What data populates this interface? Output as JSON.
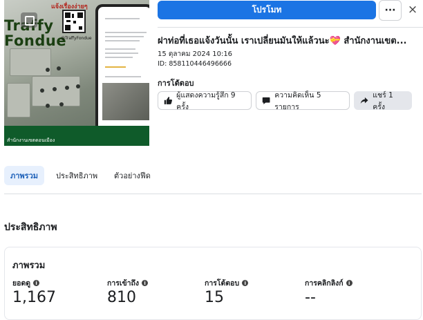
{
  "thumbnail": {
    "top_tag": "แจ้งเรื่องง่ายๆ",
    "brand_line1": "Traffy",
    "brand_line2": "Fondue",
    "handle": "@TraffyFondue",
    "footer_text": "สำนักงานเขตดอนเมือง"
  },
  "header": {
    "promote_label": "โปรโมท",
    "more_label": "···",
    "close_label": "×"
  },
  "post": {
    "title": "ฝาท่อที่เธอแจ้งวันนั้น เราเปลี่ยนมันให้แล้วนะ💝 สำนักงานเขต...",
    "date": "15 ตุลาคม 2024 10:16",
    "id": "ID: 858110446496666"
  },
  "reactions": {
    "heading": "การโต้ตอบ",
    "likes_label": "ผู้แสดงความรู้สึก 9 ครั้ง",
    "comments_label": "ความคิดเห็น 5 รายการ",
    "shares_label": "แชร์ 1 ครั้ง"
  },
  "tabs": [
    "ภาพรวม",
    "ประสิทธิภาพ",
    "ตัวอย่างฟีด"
  ],
  "performance": {
    "heading": "ประสิทธิภาพ",
    "card_title": "ภาพรวม",
    "metrics": [
      {
        "label": "ยอดดู",
        "value": "1,167"
      },
      {
        "label": "การเข้าถึง",
        "value": "810"
      },
      {
        "label": "การโต้ตอบ",
        "value": "15"
      },
      {
        "label": "การคลิกลิงก์",
        "value": "--"
      }
    ]
  },
  "colors": {
    "accent": "#1b74e4",
    "tab_active_bg": "#e7f0fd",
    "brand_green": "#0f5b2a"
  },
  "icons": [
    "play-icon",
    "more-icon",
    "close-icon",
    "thumbs-up-icon",
    "comment-icon",
    "share-icon",
    "info-icon"
  ]
}
